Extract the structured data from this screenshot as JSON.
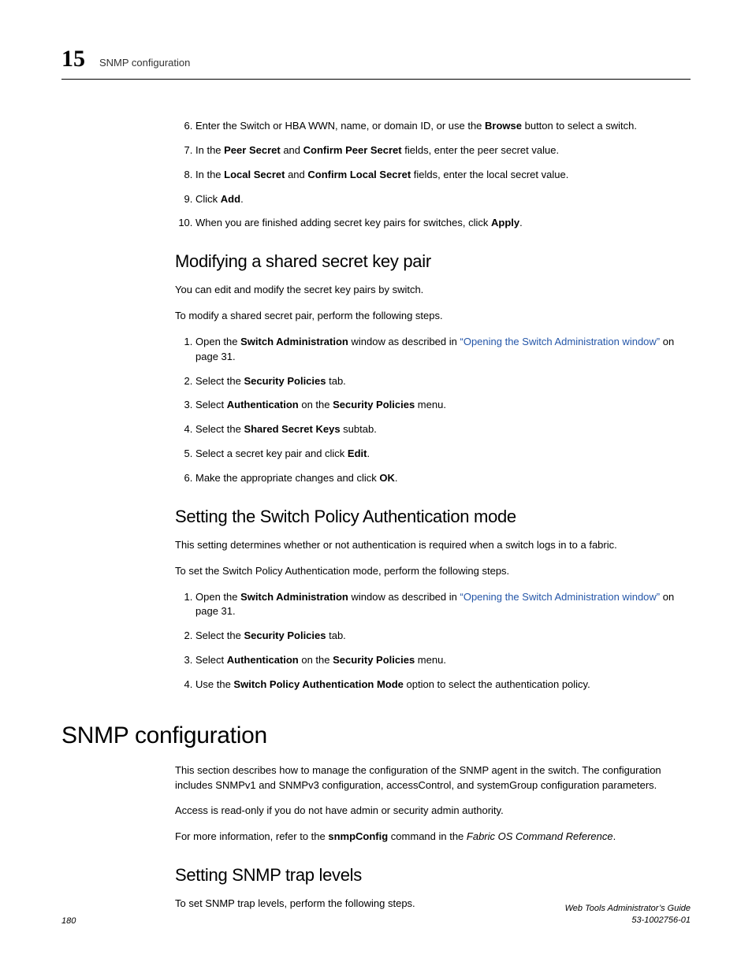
{
  "header": {
    "chapter_num": "15",
    "running_head": "SNMP configuration"
  },
  "steps_a": {
    "s6_a": "Enter the Switch or HBA WWN, name, or domain ID, or use the ",
    "s6_b": "Browse",
    "s6_c": " button to select a switch.",
    "s7_a": "In the ",
    "s7_b": "Peer Secret",
    "s7_c": " and ",
    "s7_d": "Confirm Peer Secret",
    "s7_e": " fields, enter the peer secret value.",
    "s8_a": "In the ",
    "s8_b": "Local Secret",
    "s8_c": " and ",
    "s8_d": "Confirm Local Secret",
    "s8_e": " fields, enter the local secret value.",
    "s9_a": "Click ",
    "s9_b": "Add",
    "s9_c": ".",
    "s10_a": "When you are finished adding secret key pairs for switches, click ",
    "s10_b": "Apply",
    "s10_c": "."
  },
  "sec1": {
    "title": "Modifying a shared secret key pair",
    "p1": "You can edit and modify the secret key pairs by switch.",
    "p2": "To modify a shared secret pair, perform the following steps.",
    "s1_a": "Open the ",
    "s1_b": "Switch Administration",
    "s1_c": " window as described in ",
    "s1_link": "“Opening the Switch Administration window”",
    "s1_d": " on page 31.",
    "s2_a": "Select the ",
    "s2_b": "Security Policies",
    "s2_c": " tab.",
    "s3_a": "Select ",
    "s3_b": "Authentication",
    "s3_c": " on the ",
    "s3_d": "Security Policies",
    "s3_e": " menu.",
    "s4_a": "Select the ",
    "s4_b": "Shared Secret Keys",
    "s4_c": " subtab.",
    "s5_a": "Select a secret key pair and click ",
    "s5_b": "Edit",
    "s5_c": ".",
    "s6_a": "Make the appropriate changes and click ",
    "s6_b": "OK",
    "s6_c": "."
  },
  "sec2": {
    "title": "Setting the Switch Policy Authentication mode",
    "p1": "This setting determines whether or not authentication is required when a switch logs in to a fabric.",
    "p2": "To set the Switch Policy Authentication mode, perform the following steps.",
    "s1_a": "Open the ",
    "s1_b": "Switch Administration",
    "s1_c": " window as described in ",
    "s1_link": "“Opening the Switch Administration window”",
    "s1_d": " on page 31.",
    "s2_a": "Select the ",
    "s2_b": "Security Policies",
    "s2_c": " tab.",
    "s3_a": "Select ",
    "s3_b": "Authentication",
    "s3_c": " on the ",
    "s3_d": "Security Policies",
    "s3_e": " menu.",
    "s4_a": "Use the ",
    "s4_b": "Switch Policy Authentication Mode",
    "s4_c": " option to select the authentication policy."
  },
  "main": {
    "title": "SNMP configuration",
    "p1": "This section describes how to manage the configuration of the SNMP agent in the switch. The configuration includes SNMPv1 and SNMPv3 configuration, accessControl, and systemGroup configuration parameters.",
    "p2": "Access is read-only if you do not have admin or security admin authority.",
    "p3_a": "For more information, refer to the ",
    "p3_b": "snmpConfig",
    "p3_c": " command in the ",
    "p3_d": "Fabric OS Command Reference",
    "p3_e": "."
  },
  "sec3": {
    "title": "Setting SNMP trap levels",
    "p1": "To set SNMP trap levels, perform the following steps."
  },
  "footer": {
    "page_num": "180",
    "doc_title": "Web Tools Administrator’s Guide",
    "doc_id": "53-1002756-01"
  }
}
